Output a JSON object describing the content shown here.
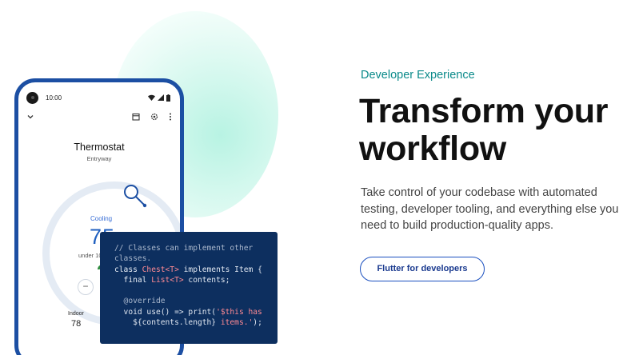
{
  "phone": {
    "status_time": "10:00",
    "title": "Thermostat",
    "subtitle": "Entryway",
    "mode": "Cooling",
    "temperature": "75",
    "under_text": "under 10",
    "minus_label": "−",
    "indoor_label": "Indoor",
    "indoor_value": "78",
    "icons": [
      "chevron-down-icon",
      "calendar-icon",
      "gear-icon",
      "more-vertical-icon",
      "wifi-icon",
      "signal-icon",
      "battery-icon",
      "leaf-icon",
      "magnifier-icon"
    ],
    "accent_color": "#1c4fa3"
  },
  "code_snippet": {
    "line1": "// Classes can implement other",
    "line2": "classes.",
    "line3_kw": "class ",
    "line3_type": "Chest<T>",
    "line3_rest": " implements Item {",
    "line4_kw": "  final ",
    "line4_type": "List<T>",
    "line4_rest": " contents;",
    "line5": "",
    "line6": "  @override",
    "line7_a": "  void use() => print(",
    "line7_str": "'$this has",
    "line8_a": "    ${contents.length}",
    "line8_str": " items.'",
    "line8_end": ");"
  },
  "hero": {
    "eyebrow": "Developer Experience",
    "headline_line1": "Transform your",
    "headline_line2": "workflow",
    "description": "Take control of your codebase with automated testing, developer tooling, and everything else you need to build production-quality apps.",
    "cta_label": "Flutter for developers",
    "eyebrow_color": "#0b8a8a",
    "cta_color": "#1a4fbf"
  }
}
